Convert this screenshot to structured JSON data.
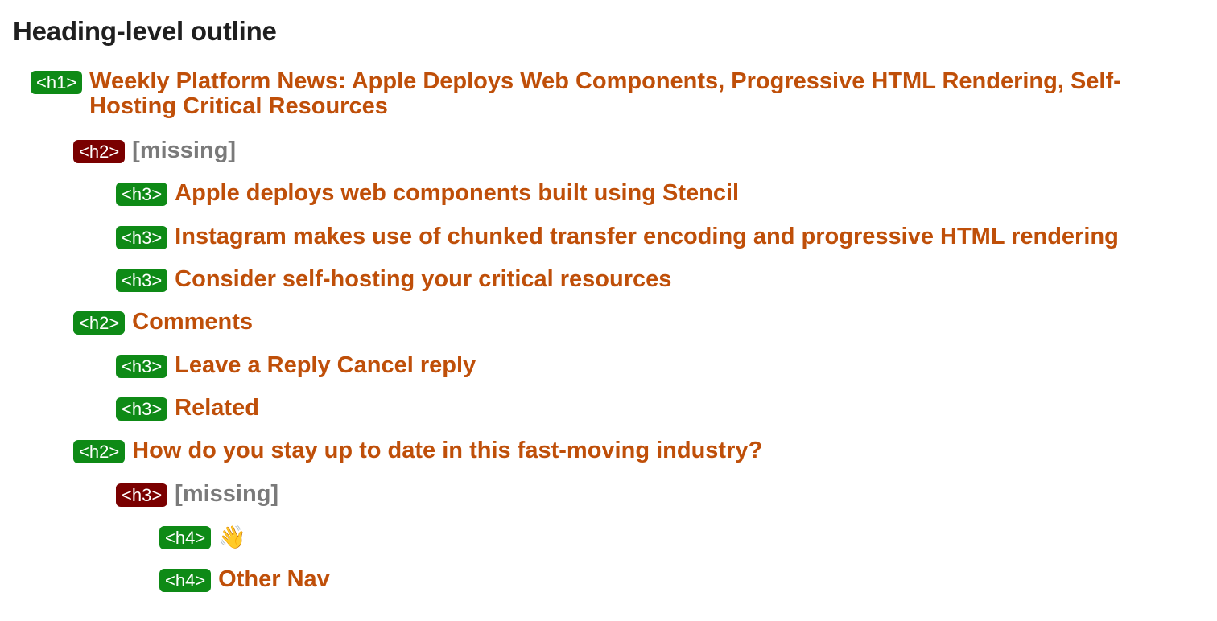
{
  "panel": {
    "title": "Heading-level outline"
  },
  "colors": {
    "ok_badge": "#0e8a16",
    "missing_badge": "#7a0000",
    "heading_text": "#bf4f09",
    "missing_text": "#7a7a7a"
  },
  "outline": [
    {
      "tag": "<h1>",
      "level": 1,
      "status": "ok",
      "text": "Weekly Platform News: Apple Deploys Web Components, Progressive HTML Rendering, Self-Hosting Critical Resources"
    },
    {
      "tag": "<h2>",
      "level": 2,
      "status": "missing",
      "text": "[missing]"
    },
    {
      "tag": "<h3>",
      "level": 3,
      "status": "ok",
      "text": "Apple deploys web components built using Stencil"
    },
    {
      "tag": "<h3>",
      "level": 3,
      "status": "ok",
      "text": "Instagram makes use of chunked transfer encoding and progressive HTML rendering"
    },
    {
      "tag": "<h3>",
      "level": 3,
      "status": "ok",
      "text": "Consider self-hosting your critical resources"
    },
    {
      "tag": "<h2>",
      "level": 2,
      "status": "ok",
      "text": "Comments"
    },
    {
      "tag": "<h3>",
      "level": 3,
      "status": "ok",
      "text": "Leave a Reply Cancel reply"
    },
    {
      "tag": "<h3>",
      "level": 3,
      "status": "ok",
      "text": "Related"
    },
    {
      "tag": "<h2>",
      "level": 2,
      "status": "ok",
      "text": "How do you stay up to date in this fast-moving industry?"
    },
    {
      "tag": "<h3>",
      "level": 3,
      "status": "missing",
      "text": "[missing]"
    },
    {
      "tag": "<h4>",
      "level": 4,
      "status": "ok",
      "text": "👋"
    },
    {
      "tag": "<h4>",
      "level": 4,
      "status": "ok",
      "text": "Other Nav"
    }
  ]
}
